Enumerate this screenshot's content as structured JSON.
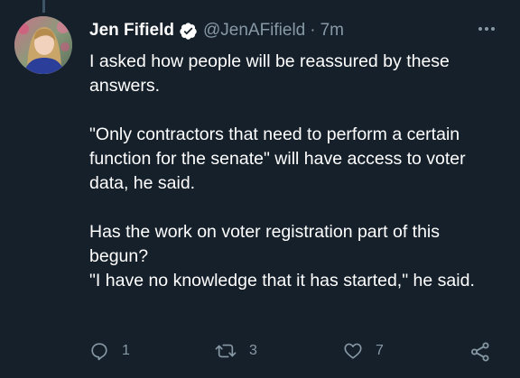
{
  "tweet": {
    "author": {
      "display_name": "Jen Fifield",
      "handle": "@JenAFifield",
      "verified": true,
      "avatar": "profile-photo"
    },
    "separator": "·",
    "time": "7m",
    "paragraphs": [
      "I asked how people will be reassured by these answers.",
      "\"Only contractors that need to perform a certain function for the senate\" will have access to voter data, he said.",
      "Has the work on voter registration part of this begun?",
      "\"I have no knowledge that it has started,\" he said."
    ],
    "actions": {
      "reply": {
        "icon": "reply-icon",
        "count": "1"
      },
      "retweet": {
        "icon": "retweet-icon",
        "count": "3"
      },
      "like": {
        "icon": "heart-icon",
        "count": "7"
      },
      "share": {
        "icon": "share-icon"
      }
    },
    "colors": {
      "background": "#15202b",
      "text": "#ffffff",
      "secondary": "#8899a6",
      "verified_badge": "#ffffff"
    }
  }
}
